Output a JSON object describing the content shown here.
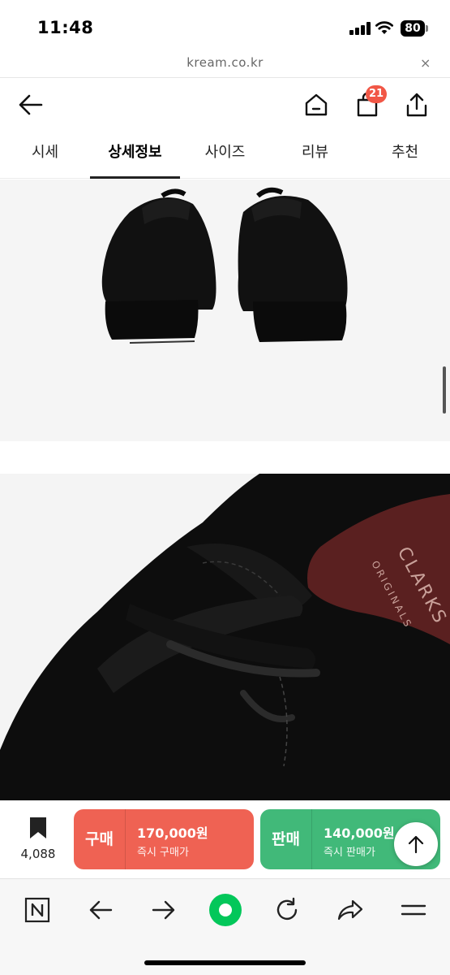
{
  "status_bar": {
    "time": "11:48",
    "battery": "80"
  },
  "url_bar": {
    "url": "kream.co.kr",
    "close_glyph": "×"
  },
  "header": {
    "back_icon": "arrow-left-icon",
    "home_icon": "home-icon",
    "cart_icon": "shopping-bag-icon",
    "cart_count": "21",
    "share_icon": "share-icon"
  },
  "tabs": [
    {
      "label": "시세",
      "active": false
    },
    {
      "label": "상세정보",
      "active": true
    },
    {
      "label": "사이즈",
      "active": false
    },
    {
      "label": "리뷰",
      "active": false
    },
    {
      "label": "추천",
      "active": false
    }
  ],
  "product_images": [
    {
      "name": "shoes-back-view",
      "bg": "#f5f5f5"
    },
    {
      "name": "shoe-closeup-view",
      "bg": "#f4f4f4",
      "insole_text": "CLARKS ORIGINALS"
    }
  ],
  "action_bar": {
    "wish_count": "4,088",
    "buy": {
      "label": "구매",
      "price": "170,000원",
      "sub": "즉시 구매가",
      "color": "#ef6253"
    },
    "sell": {
      "label": "판매",
      "price": "140,000원",
      "sub": "즉시 판매가",
      "color": "#41b979"
    }
  },
  "browser_toolbar": {
    "items": [
      "naver-n-icon",
      "back-arrow-icon",
      "forward-arrow-icon",
      "green-dot-home-icon",
      "refresh-icon",
      "share-arrow-icon",
      "menu-icon"
    ],
    "accent": "#03c75a"
  }
}
